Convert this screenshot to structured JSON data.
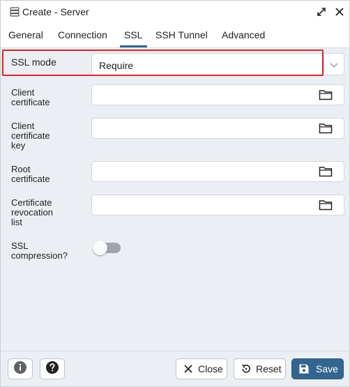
{
  "dialog": {
    "title": "Create - Server",
    "icons": {
      "server": "server-icon",
      "maximize": "maximize-icon",
      "close": "close-icon"
    }
  },
  "tabs": [
    {
      "label": "General",
      "active": false
    },
    {
      "label": "Connection",
      "active": false
    },
    {
      "label": "SSL",
      "active": true
    },
    {
      "label": "SSH Tunnel",
      "active": false
    },
    {
      "label": "Advanced",
      "active": false
    }
  ],
  "form": {
    "ssl_mode": {
      "label": "SSL mode",
      "value": "Require"
    },
    "client_certificate": {
      "label_line1": "Client",
      "label_line2": "certificate",
      "value": ""
    },
    "client_certificate_key": {
      "label_line1": "Client",
      "label_line2": "certificate",
      "label_line3": "key",
      "value": ""
    },
    "root_certificate": {
      "label_line1": "Root",
      "label_line2": "certificate",
      "value": ""
    },
    "certificate_revocation_list": {
      "label_line1": "Certificate",
      "label_line2": "revocation",
      "label_line3": "list",
      "value": ""
    },
    "ssl_compression": {
      "label_line1": "SSL",
      "label_line2": "compression?",
      "enabled": false
    }
  },
  "footer": {
    "info_icon": "info-icon",
    "help_icon": "help-icon",
    "close_label": "Close",
    "reset_label": "Reset",
    "save_label": "Save"
  },
  "colors": {
    "accent": "#326690",
    "highlight": "#d9262a",
    "panel_background": "#ebeef3"
  }
}
